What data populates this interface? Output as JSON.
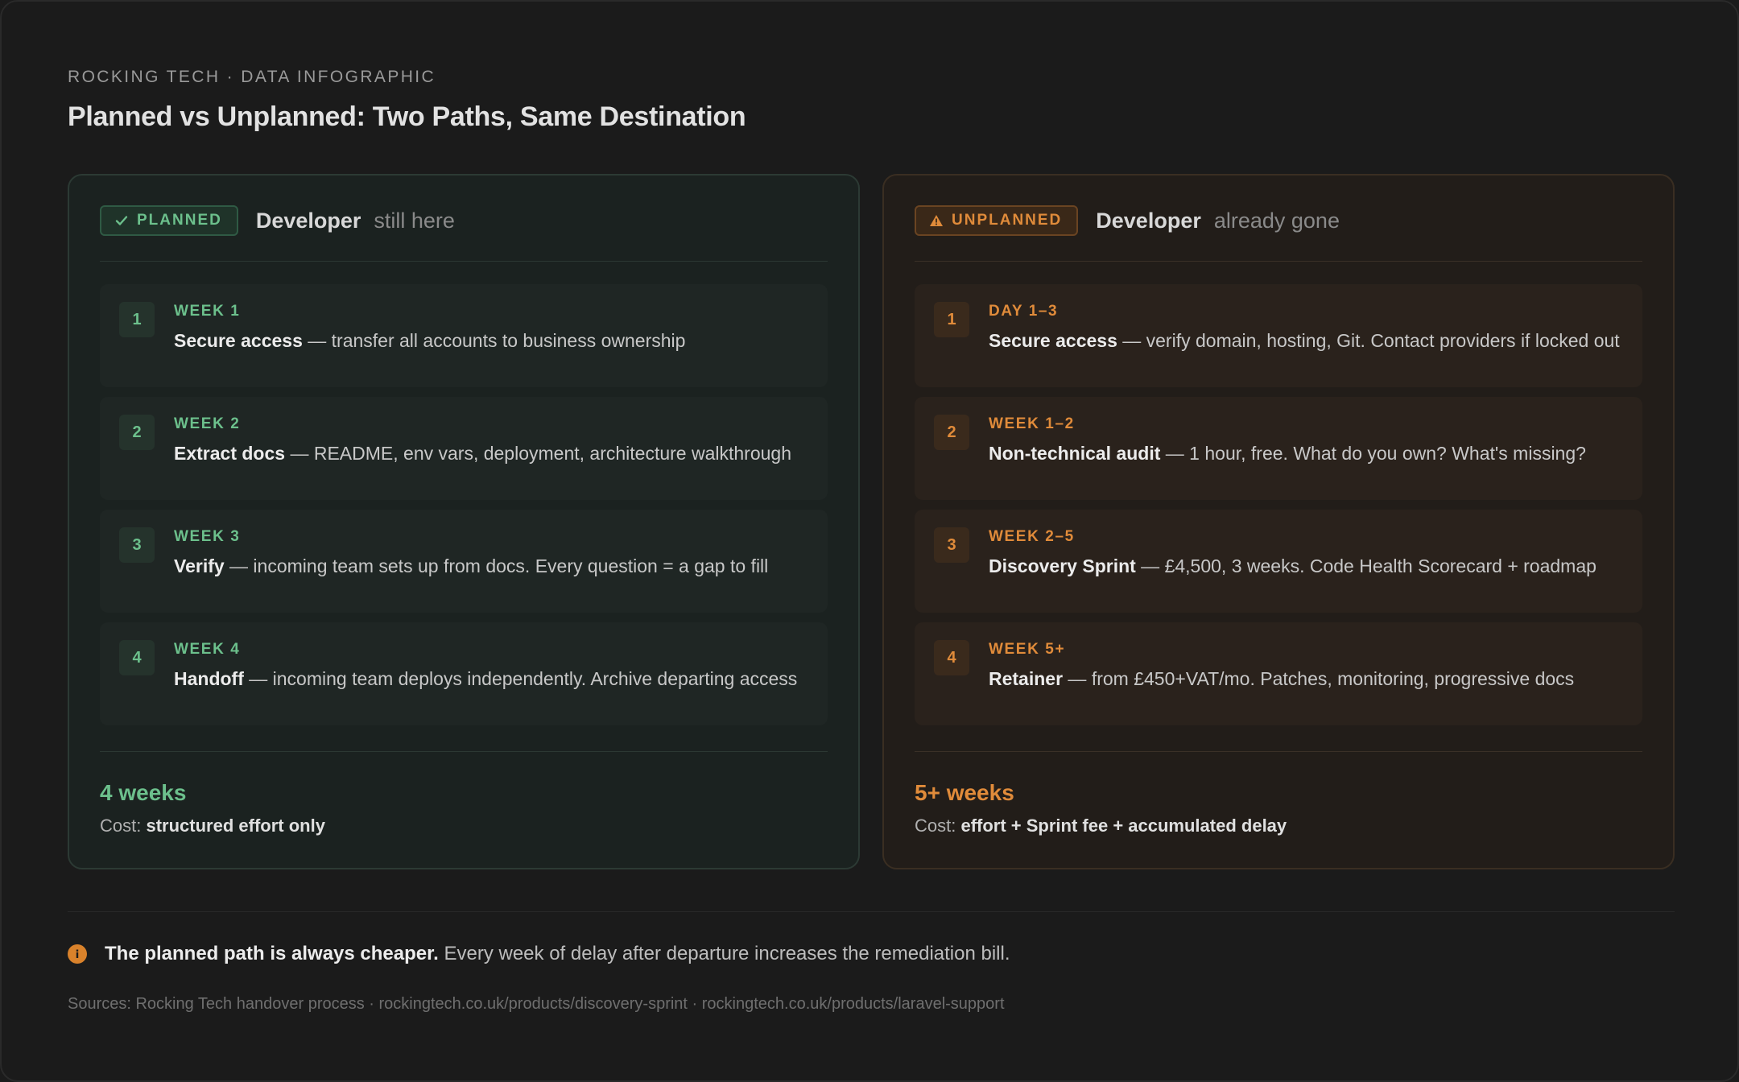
{
  "header": {
    "eyebrow": "ROCKING TECH · DATA INFOGRAPHIC",
    "title": "Planned vs Unplanned: Two Paths, Same Destination"
  },
  "colors": {
    "planned": "#6cc08c",
    "unplanned": "#e08b3a",
    "background": "#1b1b1b"
  },
  "planned": {
    "badge": "PLANNED",
    "badge_icon": "check-icon",
    "who": "Developer",
    "state": "still here",
    "steps": [
      {
        "num": "1",
        "when": "WEEK 1",
        "title": "Secure access",
        "text": " — transfer all accounts to business ownership"
      },
      {
        "num": "2",
        "when": "WEEK 2",
        "title": "Extract docs",
        "text": " — README, env vars, deployment, architecture walkthrough"
      },
      {
        "num": "3",
        "when": "WEEK 3",
        "title": "Verify",
        "text": " — incoming team sets up from docs. Every question = a gap to fill"
      },
      {
        "num": "4",
        "when": "WEEK 4",
        "title": "Handoff",
        "text": " — incoming team deploys independently. Archive departing access"
      }
    ],
    "duration": "4 weeks",
    "cost_label": "Cost: ",
    "cost_value": "structured effort only"
  },
  "unplanned": {
    "badge": "UNPLANNED",
    "badge_icon": "warning-icon",
    "who": "Developer",
    "state": "already gone",
    "steps": [
      {
        "num": "1",
        "when": "DAY 1–3",
        "title": "Secure access",
        "text": " — verify domain, hosting, Git. Contact providers if locked out"
      },
      {
        "num": "2",
        "when": "WEEK 1–2",
        "title": "Non-technical audit",
        "text": " — 1 hour, free. What do you own? What's missing?"
      },
      {
        "num": "3",
        "when": "WEEK 2–5",
        "title": "Discovery Sprint",
        "text": " — £4,500, 3 weeks. Code Health Scorecard + roadmap"
      },
      {
        "num": "4",
        "when": "WEEK 5+",
        "title": "Retainer",
        "text": " — from £450+VAT/mo. Patches, monitoring, progressive docs"
      }
    ],
    "duration": "5+ weeks",
    "cost_label": "Cost: ",
    "cost_value": "effort + Sprint fee + accumulated delay"
  },
  "note": {
    "icon": "info-icon",
    "bold": "The planned path is always cheaper.",
    "text": " Every week of delay after departure increases the remediation bill."
  },
  "sources": "Sources: Rocking Tech handover process · rockingtech.co.uk/products/discovery-sprint · rockingtech.co.uk/products/laravel-support"
}
